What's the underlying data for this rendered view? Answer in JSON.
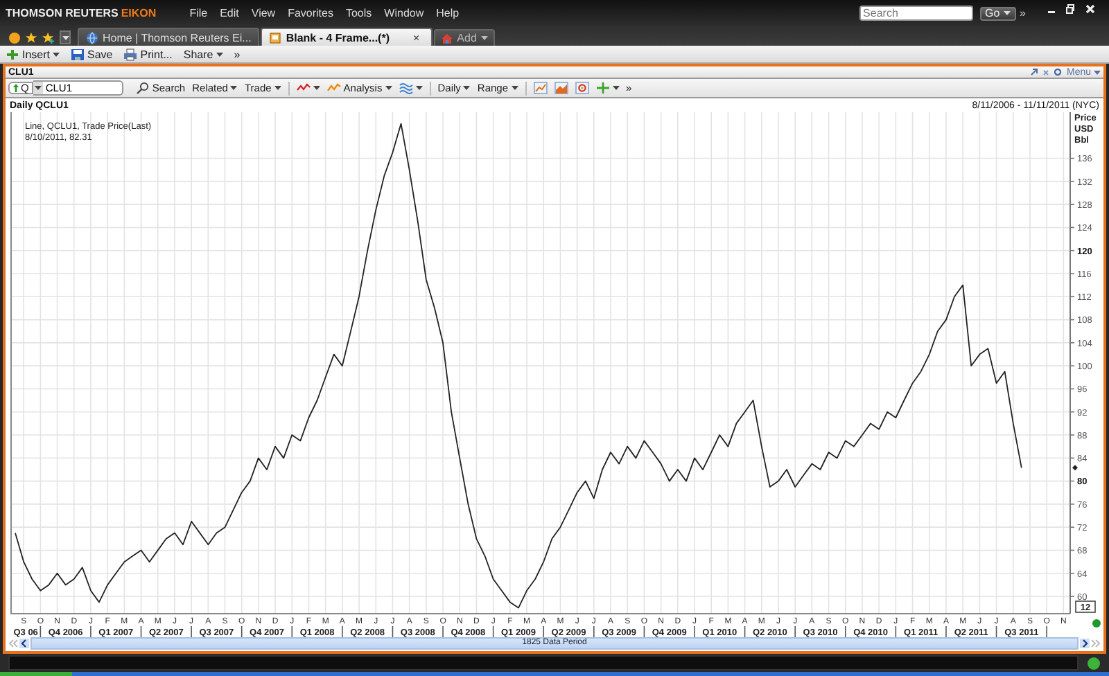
{
  "title_bar": {
    "brand": "THOMSON REUTERS",
    "product": "EIKON",
    "menu": [
      "File",
      "Edit",
      "View",
      "Favorites",
      "Tools",
      "Window",
      "Help"
    ],
    "search": {
      "placeholder": "Search"
    },
    "go_button": "Go",
    "more": "»"
  },
  "tabs": [
    {
      "label": "Home | Thomson Reuters Ei...",
      "selected": false
    },
    {
      "label": "Blank - 4 Frame...(*)",
      "selected": true,
      "close": "×"
    }
  ],
  "add_tab": "Add",
  "toolbar": {
    "items": [
      {
        "kind": "insert",
        "label": "Insert",
        "dropdown": true
      },
      {
        "kind": "save",
        "label": "Save",
        "dropdown": false
      },
      {
        "kind": "print",
        "label": "Print...",
        "dropdown": false
      },
      {
        "kind": "share",
        "label": "Share",
        "dropdown": true
      }
    ],
    "more": "»"
  },
  "frame": {
    "title": "CLU1",
    "menu_label": "Menu"
  },
  "chart_toolbar": {
    "symbol": {
      "prefix": "Q",
      "value": "CLU1"
    },
    "items": [
      {
        "kind": "search",
        "label": "Search",
        "dropdown": false
      },
      {
        "kind": "related",
        "label": "Related",
        "dropdown": true
      },
      {
        "kind": "trade",
        "label": "Trade",
        "dropdown": true
      },
      {
        "kind": "line",
        "dropdown": true
      },
      {
        "kind": "analysis",
        "label": "Analysis",
        "dropdown": true
      },
      {
        "kind": "wave",
        "dropdown": true
      },
      {
        "kind": "interval",
        "label": "Daily",
        "dropdown": true
      },
      {
        "kind": "range",
        "label": "Range",
        "dropdown": true
      },
      {
        "kind": "chart-line",
        "dropdown": false
      },
      {
        "kind": "chart-area",
        "dropdown": false
      },
      {
        "kind": "chart-settings",
        "dropdown": false
      },
      {
        "kind": "crosshair",
        "dropdown": true
      }
    ],
    "more": "»"
  },
  "chart": {
    "date_range": "8/11/2006 - 11/11/2011 (NYC)",
    "legend": [
      "Line, QCLU1, Trade Price(Last)",
      "8/10/2011, 82.31"
    ],
    "period_labels": [
      "Q3 06",
      "Q4 2006",
      "Q1 2007",
      "Q2 2007",
      "Q3 2007",
      "Q4 2007",
      "Q1 2008",
      "Q2 2008",
      "Q3 2008",
      "Q4 2008",
      "Q1 2009",
      "Q2 2009",
      "Q3 2009",
      "Q4 2009",
      "Q1 2010",
      "Q2 2010",
      "Q3 2010",
      "Q4 2010",
      "Q1 2011",
      "Q2 2011",
      "Q3 2011"
    ],
    "data_period": "1825 Data Period",
    "zoom_label": "12",
    "chart_data": {
      "type": "line",
      "title": "Daily QCLU1",
      "ylabel": "Price USD Bbl",
      "categories": [
        null,
        "S",
        null,
        "O",
        null,
        "N",
        null,
        "D",
        null,
        "J",
        null,
        "F",
        null,
        "M",
        null,
        "A",
        null,
        "M",
        null,
        "J",
        null,
        "J",
        null,
        "A",
        null,
        "S",
        null,
        "O",
        null,
        "N",
        null,
        "D",
        null,
        "J",
        null,
        "F",
        null,
        "M",
        null,
        "A",
        null,
        "M",
        null,
        "J",
        null,
        "J",
        null,
        "A",
        null,
        "S",
        null,
        "O",
        null,
        "N",
        null,
        "D",
        null,
        "J",
        null,
        "F",
        null,
        "M",
        null,
        "A",
        null,
        "M",
        null,
        "J",
        null,
        "J",
        null,
        "A",
        null,
        "S",
        null,
        "O",
        null,
        "N",
        null,
        "D",
        null,
        "J",
        null,
        "F",
        null,
        "M",
        null,
        "A",
        null,
        "M",
        null,
        "J",
        null,
        "J",
        null,
        "A",
        null,
        "S",
        null,
        "O",
        null,
        "N",
        null,
        "D",
        null,
        "J",
        null,
        "F",
        null,
        "M",
        null,
        "A",
        null,
        "M",
        null,
        "J",
        null,
        "J",
        null,
        "A",
        null,
        "S",
        null,
        "O",
        null,
        "N"
      ],
      "ylim": [
        57,
        144
      ],
      "grid": true,
      "series": [
        {
          "color": "#222222",
          "values": [
            71,
            66,
            63,
            61,
            62,
            64,
            62,
            63,
            65,
            61,
            59,
            62,
            64,
            66,
            67,
            68,
            66,
            68,
            70,
            71,
            69,
            73,
            71,
            69,
            71,
            72,
            75,
            78,
            80,
            84,
            82,
            86,
            84,
            88,
            87,
            91,
            94,
            98,
            102,
            100,
            106,
            112,
            120,
            127,
            133,
            137,
            142,
            134,
            125,
            115,
            110,
            104,
            92,
            84,
            76,
            70,
            67,
            63,
            61,
            59,
            58,
            61,
            63,
            66,
            70,
            72,
            75,
            78,
            80,
            77,
            82,
            85,
            83,
            86,
            84,
            87,
            85,
            83,
            80,
            82,
            80,
            84,
            82,
            85,
            88,
            86,
            90,
            92,
            94,
            86,
            79,
            80,
            82,
            79,
            81,
            83,
            82,
            85,
            84,
            87,
            86,
            88,
            90,
            89,
            92,
            91,
            94,
            97,
            99,
            102,
            106,
            108,
            112,
            114,
            100,
            102,
            103,
            97,
            99,
            90,
            82.31,
            null,
            null,
            null,
            null,
            null
          ]
        }
      ],
      "yticks": [
        60,
        64,
        68,
        72,
        76,
        80,
        84,
        88,
        92,
        96,
        100,
        104,
        108,
        112,
        116,
        120,
        124,
        128,
        132,
        136
      ]
    }
  }
}
